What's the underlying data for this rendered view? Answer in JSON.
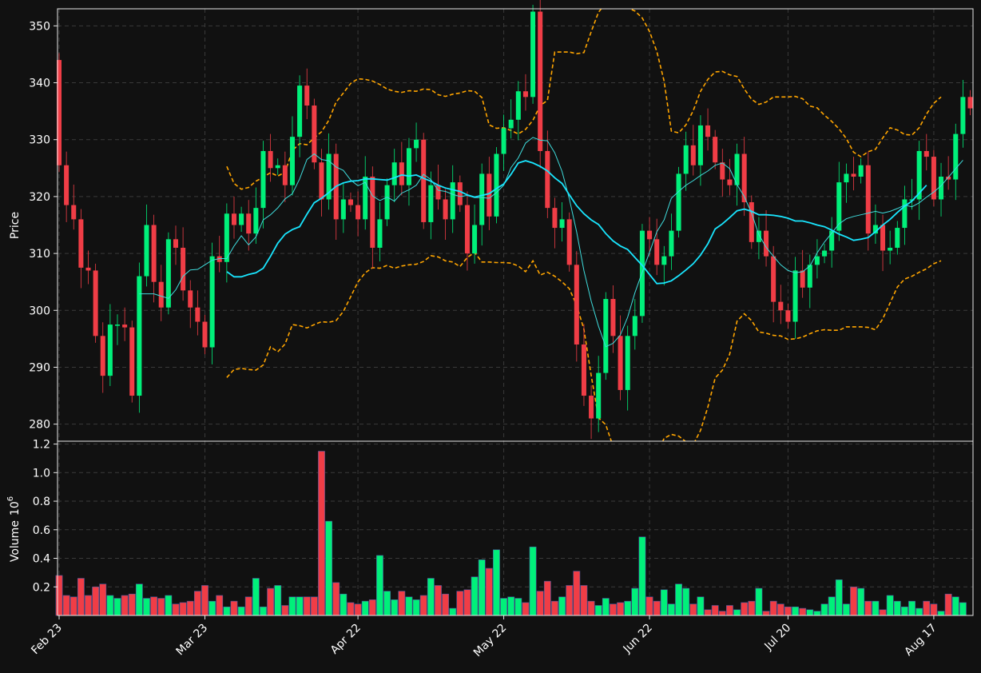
{
  "chart_data": [
    {
      "type": "candlestick",
      "title": "",
      "xlabel": "",
      "ylabel": "Price",
      "ylim": [
        277,
        353
      ],
      "yticks": [
        280,
        290,
        300,
        310,
        320,
        330,
        340,
        350
      ],
      "xticks": [
        "Feb 23",
        "Mar 23",
        "Apr 22",
        "May 22",
        "Jun 22",
        "Jul 20",
        "Aug 17"
      ],
      "grid": true,
      "colors": {
        "up": "#00f07a",
        "down": "#f03d46",
        "ma_fast": "#3fdcdc",
        "ma_slow": "#19e6ff",
        "bands": "#ffa500"
      },
      "series_close": [
        325.5,
        318.5,
        316.0,
        307.5,
        307.0,
        295.5,
        288.5,
        297.5,
        297.5,
        297.0,
        285.0,
        306.0,
        315.0,
        305.0,
        300.5,
        312.5,
        311.0,
        303.5,
        300.5,
        298.0,
        293.5,
        309.5,
        308.5,
        317.0,
        315.0,
        317.0,
        313.5,
        318.0,
        328.0,
        325.0,
        325.5,
        322.0,
        330.5,
        339.5,
        336.0,
        326.0,
        319.5,
        327.5,
        316.0,
        319.5,
        318.5,
        316.0,
        323.5,
        311.0,
        316.0,
        322.0,
        326.0,
        322.0,
        328.5,
        330.0,
        315.5,
        322.0,
        319.5,
        316.0,
        322.5,
        318.5,
        310.0,
        315.0,
        324.0,
        316.5,
        327.5,
        332.0,
        333.5,
        338.5,
        337.5,
        352.5,
        328.0,
        318.0,
        314.5,
        316.0,
        308.0,
        294.0,
        285.0,
        281.0,
        289.0,
        302.0,
        295.5,
        286.0,
        295.5,
        299.0,
        314.0,
        312.5,
        308.0,
        309.5,
        314.0,
        324.0,
        329.0,
        325.5,
        332.5,
        330.5,
        326.0,
        323.0,
        322.0,
        327.5,
        319.0,
        312.0,
        314.0,
        309.5,
        301.5,
        300.0,
        298.0,
        307.0,
        304.0,
        308.0,
        309.5,
        310.5,
        314.0,
        322.5,
        324.0,
        323.5,
        325.5,
        313.5,
        315.0,
        310.5,
        311.0,
        314.5,
        319.5,
        319.5,
        328.0,
        327.0,
        319.5,
        323.5,
        323.0,
        331.0,
        337.5,
        335.5
      ],
      "ma_fast": [
        null,
        null,
        null,
        null,
        null,
        null,
        null,
        null,
        null,
        null,
        null,
        302.9,
        302.9,
        302.9,
        302.5,
        302.1,
        303.6,
        306.0,
        307.1,
        307.2,
        308.0,
        308.8,
        309.1,
        309.1,
        311.3,
        313.1,
        311.5,
        312.9,
        315.9,
        316.8,
        318.0,
        319.6,
        320.5,
        323.1,
        326.5,
        327.5,
        326.5,
        326.3,
        325.2,
        324.6,
        322.9,
        321.9,
        322.5,
        320.1,
        319.3,
        319.9,
        319.2,
        320.6,
        321.2,
        322.0,
        323.9,
        323.0,
        321.1,
        320.9,
        320.4,
        320.0,
        320.2,
        319.8,
        319.8,
        319.7,
        320.7,
        322.0,
        325.1,
        326.8,
        329.4,
        330.4,
        329.9,
        329.8,
        327.7,
        324.4,
        319.6,
        313.8,
        307.0,
        301.6,
        297.2,
        293.6,
        294.2,
        295.7,
        298.8,
        303.1,
        306.7,
        310.2,
        313.8,
        315.9,
        319.7,
        320.9,
        322.0,
        322.8,
        323.7,
        324.5,
        325.5,
        325.9,
        324.9,
        322.1,
        320.0,
        317.1,
        313.3,
        311.1,
        309.5,
        308.0,
        307.0,
        306.6,
        306.8,
        307.8,
        310.1,
        312.0,
        313.6,
        315.2,
        316.1,
        316.5,
        316.8,
        317.1,
        317.4,
        317.1,
        317.4,
        317.9,
        318.5,
        318.2,
        318.9,
        319.9,
        320.8,
        321.9,
        323.4,
        324.9,
        326.4
      ],
      "ma_slow": [
        null,
        null,
        null,
        null,
        null,
        null,
        null,
        null,
        null,
        null,
        null,
        null,
        null,
        null,
        null,
        null,
        null,
        null,
        null,
        null,
        null,
        null,
        null,
        306.8,
        305.9,
        305.9,
        306.3,
        306.6,
        307.4,
        309.5,
        311.8,
        313.4,
        314.2,
        314.7,
        316.9,
        318.9,
        319.7,
        320.7,
        321.8,
        322.4,
        322.7,
        322.8,
        323.1,
        323.1,
        323.0,
        322.9,
        323.3,
        323.8,
        323.6,
        323.8,
        323.2,
        322.7,
        322.0,
        321.5,
        321.2,
        320.9,
        320.3,
        319.9,
        320.2,
        320.5,
        321.4,
        322.2,
        323.9,
        325.9,
        326.3,
        325.9,
        325.3,
        324.5,
        323.3,
        322.3,
        320.3,
        318.4,
        317.0,
        315.9,
        315.1,
        313.5,
        312.2,
        311.3,
        310.7,
        309.3,
        307.9,
        306.3,
        304.7,
        304.8,
        305.2,
        306.1,
        307.1,
        308.2,
        309.7,
        311.7,
        314.3,
        315.2,
        316.3,
        317.5,
        317.8,
        317.4,
        316.8,
        316.8,
        316.7,
        316.5,
        316.2,
        315.7,
        315.7,
        315.4,
        315.0,
        314.7,
        314.1,
        313.4,
        312.9,
        312.3,
        312.5,
        312.8,
        313.8,
        315.0,
        316.0,
        317.2,
        318.3,
        319.2,
        320.6,
        322.0
      ],
      "band_upper": [
        null,
        null,
        null,
        null,
        null,
        null,
        null,
        null,
        null,
        null,
        null,
        null,
        null,
        null,
        null,
        null,
        null,
        null,
        null,
        null,
        null,
        null,
        null,
        325.3,
        322.3,
        321.3,
        321.6,
        322.7,
        323.4,
        324.2,
        323.6,
        324.3,
        328.1,
        329.3,
        329.1,
        330.3,
        331.4,
        333.4,
        336.6,
        338.2,
        339.9,
        340.7,
        340.6,
        340.3,
        339.7,
        338.9,
        338.5,
        338.3,
        338.6,
        338.5,
        338.9,
        338.8,
        337.9,
        337.6,
        338.0,
        338.2,
        338.6,
        338.5,
        337.4,
        332.6,
        332.0,
        332.1,
        331.6,
        331.0,
        331.8,
        333.4,
        336.0,
        336.9,
        345.4,
        345.4,
        345.4,
        345.1,
        345.3,
        349.0,
        352.4,
        354.0,
        353.6,
        353.7,
        353.2,
        352.6,
        351.4,
        349.0,
        345.5,
        340.3,
        331.5,
        331.2,
        332.6,
        335.1,
        338.5,
        340.6,
        341.9,
        342.0,
        341.4,
        341.1,
        338.9,
        337.1,
        336.2,
        336.6,
        337.5,
        337.5,
        337.5,
        337.6,
        337.2,
        335.9,
        335.6,
        334.3,
        333.2,
        331.9,
        330.2,
        327.8,
        327.0,
        327.9,
        328.3,
        330.3,
        332.1,
        331.7,
        330.9,
        330.8,
        332.1,
        334.5,
        336.4,
        337.5
      ],
      "band_lower": [
        null,
        null,
        null,
        null,
        null,
        null,
        null,
        null,
        null,
        null,
        null,
        null,
        null,
        null,
        null,
        null,
        null,
        null,
        null,
        null,
        null,
        null,
        null,
        288.2,
        289.6,
        289.8,
        289.6,
        289.5,
        290.4,
        293.6,
        292.7,
        294.1,
        297.5,
        297.3,
        296.9,
        297.5,
        298.0,
        297.9,
        298.2,
        299.8,
        302.4,
        305.0,
        306.6,
        307.5,
        307.4,
        307.9,
        307.4,
        307.8,
        308.0,
        308.1,
        308.6,
        309.6,
        309.4,
        308.7,
        308.5,
        307.7,
        309.3,
        310.2,
        308.5,
        308.5,
        308.4,
        308.4,
        308.3,
        307.8,
        306.8,
        308.7,
        306.2,
        306.7,
        306.0,
        305.0,
        303.8,
        300.9,
        296.7,
        288.5,
        281.1,
        279.9,
        276.1,
        274.1,
        271.3,
        269.7,
        272.4,
        272.8,
        274.6,
        277.5,
        278.2,
        277.9,
        276.9,
        276.4,
        278.9,
        283.0,
        288.1,
        289.5,
        292.3,
        298.1,
        299.4,
        298.2,
        296.2,
        296.0,
        295.6,
        295.5,
        294.9,
        295.0,
        295.3,
        295.9,
        296.4,
        296.6,
        296.5,
        296.5,
        297.1,
        297.1,
        297.1,
        297.0,
        296.6,
        298.5,
        301.3,
        304.1,
        305.5,
        306.0,
        306.7,
        307.3,
        308.2,
        308.7
      ]
    },
    {
      "type": "bar",
      "title": "",
      "xlabel": "",
      "ylabel": "Volume",
      "ylabel_exponent": "6",
      "ylim": [
        0,
        1.22
      ],
      "yticks": [
        "0.2",
        "0.4",
        "0.6",
        "0.8",
        "1.0",
        "1.2"
      ],
      "xticks": [
        "Feb 23",
        "Mar 23",
        "Apr 22",
        "May 22",
        "Jun 22",
        "Jul 20",
        "Aug 17"
      ],
      "grid": true,
      "values": [
        0.28,
        0.14,
        0.13,
        0.26,
        0.14,
        0.2,
        0.22,
        0.14,
        0.12,
        0.14,
        0.15,
        0.22,
        0.12,
        0.13,
        0.12,
        0.14,
        0.08,
        0.09,
        0.1,
        0.17,
        0.21,
        0.1,
        0.14,
        0.06,
        0.1,
        0.06,
        0.13,
        0.26,
        0.06,
        0.19,
        0.21,
        0.07,
        0.13,
        0.13,
        0.13,
        0.13,
        1.15,
        0.66,
        0.23,
        0.15,
        0.09,
        0.08,
        0.1,
        0.11,
        0.42,
        0.17,
        0.11,
        0.17,
        0.13,
        0.11,
        0.14,
        0.26,
        0.21,
        0.15,
        0.05,
        0.17,
        0.18,
        0.27,
        0.39,
        0.33,
        0.46,
        0.12,
        0.13,
        0.12,
        0.09,
        0.48,
        0.17,
        0.24,
        0.1,
        0.13,
        0.21,
        0.31,
        0.21,
        0.1,
        0.07,
        0.12,
        0.08,
        0.09,
        0.1,
        0.19,
        0.55,
        0.13,
        0.1,
        0.18,
        0.08,
        0.22,
        0.19,
        0.08,
        0.13,
        0.04,
        0.07,
        0.03,
        0.07,
        0.04,
        0.09,
        0.1,
        0.19,
        0.03,
        0.1,
        0.08,
        0.06,
        0.06,
        0.05,
        0.04,
        0.03,
        0.08,
        0.13,
        0.25,
        0.08,
        0.2,
        0.19,
        0.1,
        0.1,
        0.04,
        0.14,
        0.1,
        0.06,
        0.1,
        0.05,
        0.1,
        0.08,
        0.03,
        0.15,
        0.13,
        0.09
      ]
    }
  ]
}
